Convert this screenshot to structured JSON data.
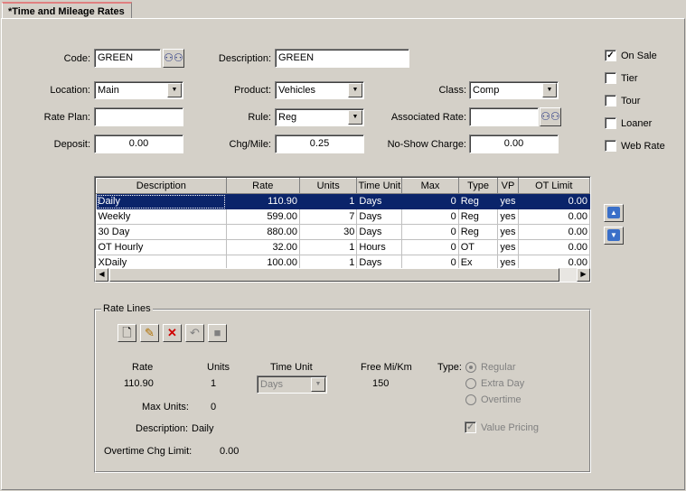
{
  "tab": {
    "title": "*Time and Mileage Rates"
  },
  "form": {
    "code": {
      "label": "Code:",
      "value": "GREEN"
    },
    "description": {
      "label": "Description:",
      "value": "GREEN"
    },
    "location": {
      "label": "Location:",
      "value": "Main"
    },
    "product": {
      "label": "Product:",
      "value": "Vehicles"
    },
    "class": {
      "label": "Class:",
      "value": "Comp"
    },
    "rate_plan": {
      "label": "Rate Plan:",
      "value": ""
    },
    "rule": {
      "label": "Rule:",
      "value": "Reg"
    },
    "associated_rate": {
      "label": "Associated Rate:",
      "value": ""
    },
    "deposit": {
      "label": "Deposit:",
      "value": "0.00"
    },
    "chg_mile": {
      "label": "Chg/Mile:",
      "value": "0.25"
    },
    "no_show": {
      "label": "No-Show Charge:",
      "value": "0.00"
    }
  },
  "checkboxes": [
    {
      "label": "On Sale",
      "checked": true
    },
    {
      "label": "Tier",
      "checked": false
    },
    {
      "label": "Tour",
      "checked": false
    },
    {
      "label": "Loaner",
      "checked": false
    },
    {
      "label": "Web Rate",
      "checked": false
    }
  ],
  "grid": {
    "columns": [
      "Description",
      "Rate",
      "Units",
      "Time Unit",
      "Max",
      "Type",
      "VP",
      "OT Limit"
    ],
    "rows": [
      [
        "Daily",
        "110.90",
        "1",
        "Days",
        "0",
        "Reg",
        "yes",
        "0.00"
      ],
      [
        "Weekly",
        "599.00",
        "7",
        "Days",
        "0",
        "Reg",
        "yes",
        "0.00"
      ],
      [
        "30 Day",
        "880.00",
        "30",
        "Days",
        "0",
        "Reg",
        "yes",
        "0.00"
      ],
      [
        "OT Hourly",
        "32.00",
        "1",
        "Hours",
        "0",
        "OT",
        "yes",
        "0.00"
      ],
      [
        "XDaily",
        "100.00",
        "1",
        "Days",
        "0",
        "Ex",
        "yes",
        "0.00"
      ]
    ],
    "selected_row": 0
  },
  "rate_lines": {
    "title": "Rate Lines",
    "rate_label": "Rate",
    "rate_value": "110.90",
    "units_label": "Units",
    "units_value": "1",
    "time_unit_label": "Time Unit",
    "time_unit_value": "Days",
    "free_mi_label": "Free Mi/Km",
    "free_mi_value": "150",
    "type_label": "Type:",
    "type_options": [
      "Regular",
      "Extra Day",
      "Overtime"
    ],
    "type_selected": "Regular",
    "max_units_label": "Max Units:",
    "max_units_value": "0",
    "description_label": "Description:",
    "description_value": "Daily",
    "ot_limit_label": "Overtime Chg Limit:",
    "ot_limit_value": "0.00",
    "value_pricing_label": "Value Pricing",
    "value_pricing_checked": true
  },
  "icons": {
    "search": "binoculars-icon",
    "toolbar": [
      "new-icon",
      "edit-icon",
      "delete-icon",
      "undo-icon",
      "save-icon"
    ]
  },
  "colors": {
    "selection": "#0a246a",
    "tab_accent": "#e08080",
    "face": "#d4d0c8"
  }
}
